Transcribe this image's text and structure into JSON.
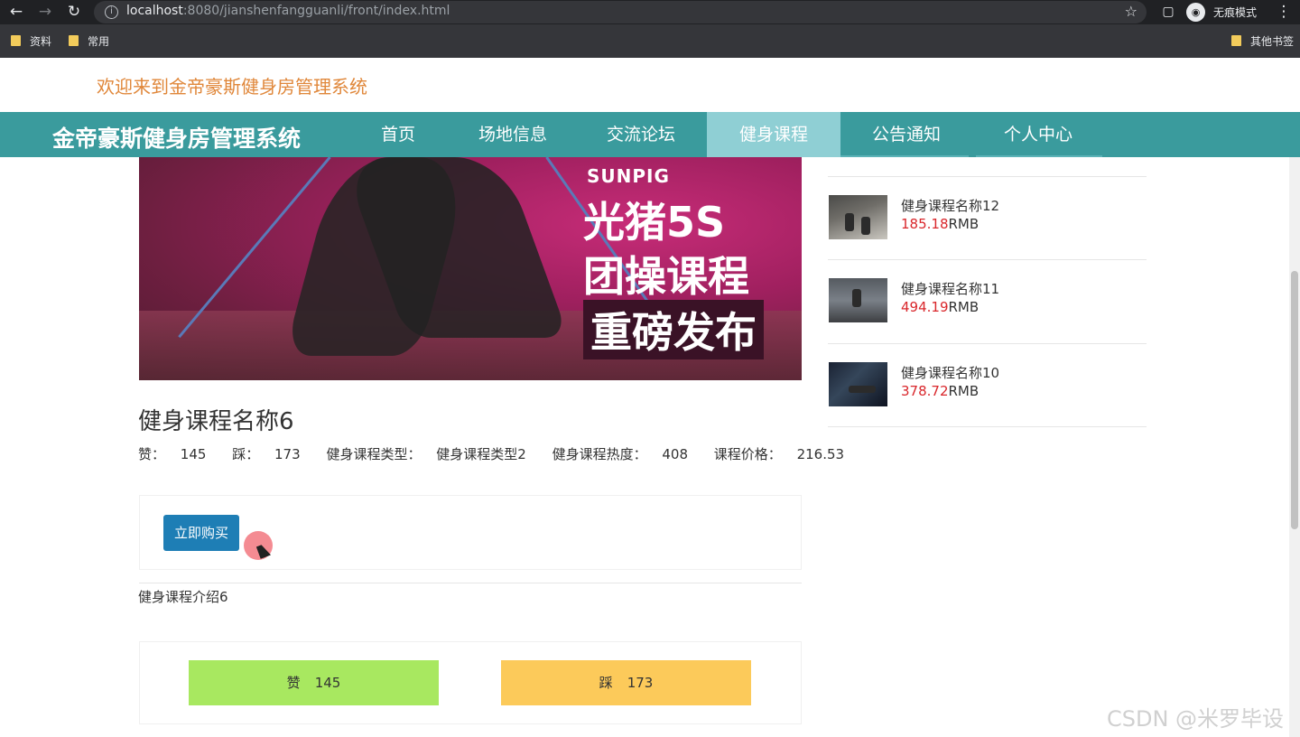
{
  "browser": {
    "url_host": "localhost",
    "url_path": ":8080/jianshenfangguanli/front/index.html",
    "incognito_label": "无痕模式",
    "bookmarks": [
      "资料",
      "常用"
    ],
    "other_bookmarks": "其他书签"
  },
  "site": {
    "welcome": "欢迎来到金帝豪斯健身房管理系统",
    "brand": "金帝豪斯健身房管理系统",
    "nav": [
      "首页",
      "场地信息",
      "交流论坛",
      "健身课程",
      "公告通知",
      "个人中心"
    ],
    "active_nav": "健身课程"
  },
  "banner": {
    "tag": "SUNPIG",
    "line1": "光猪5S",
    "line2": "团操课程",
    "line3": "重磅发布"
  },
  "course": {
    "title": "健身课程名称6",
    "likes_label": "赞：",
    "likes": "145",
    "dislikes_label": "踩：",
    "dislikes": "173",
    "type_label": "健身课程类型：",
    "type": "健身课程类型2",
    "heat_label": "健身课程热度：",
    "heat": "408",
    "price_label": "课程价格：",
    "price": "216.53",
    "buy_button": "立即购买",
    "intro": "健身课程介绍6",
    "vote_like_label": "赞",
    "vote_dislike_label": "踩"
  },
  "sidebar": {
    "currency": "RMB",
    "items": [
      {
        "name": "健身课程名称12",
        "price": "185.18"
      },
      {
        "name": "健身课程名称11",
        "price": "494.19"
      },
      {
        "name": "健身课程名称10",
        "price": "378.72"
      }
    ]
  },
  "watermark": "CSDN @米罗毕设",
  "colors": {
    "navbar": "#3a9b9d",
    "nav_active": "#8fcfd4",
    "welcome": "#e0873a",
    "buy_button": "#1e7eb5",
    "like": "#a8e860",
    "dislike": "#fcca5a",
    "price": "#d9262b"
  }
}
